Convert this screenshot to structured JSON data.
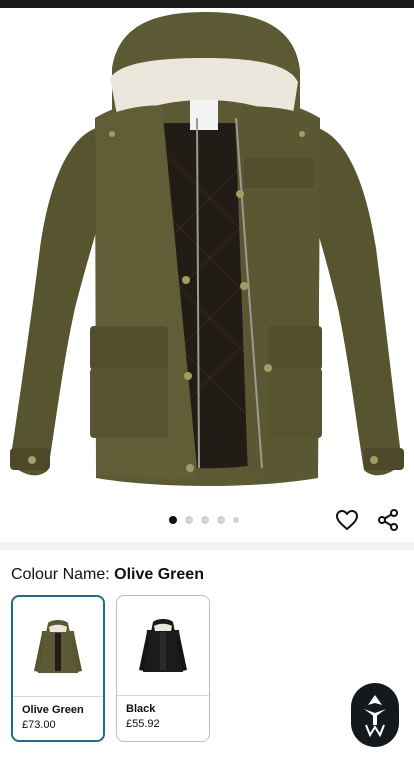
{
  "product": {
    "image_alt": "olive green hooded parka jacket",
    "image_count": 5,
    "active_image": 1
  },
  "actions": {
    "wishlist_icon": "heart-icon",
    "share_icon": "share-icon"
  },
  "variation": {
    "label": "Colour Name:",
    "selected_value": "Olive Green",
    "options": [
      {
        "name": "Olive Green",
        "price": "£73.00",
        "selected": true,
        "color": "#5c5a35"
      },
      {
        "name": "Black",
        "price": "£55.92",
        "selected": false,
        "color": "#1b1b1d"
      }
    ]
  },
  "fab": {
    "icon": "brand-logo-icon"
  },
  "colors": {
    "accent": "#1f6e80",
    "jacket": "#5c5a35"
  }
}
